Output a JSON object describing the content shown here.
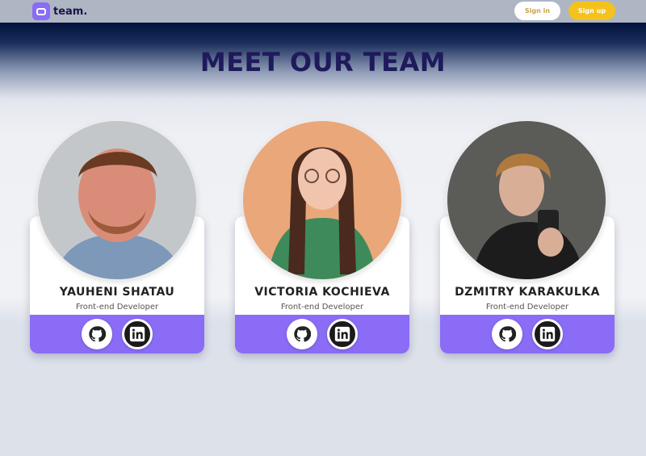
{
  "header": {
    "logo_text": "team.",
    "signin_label": "Sign in",
    "signup_label": "Sign up"
  },
  "page": {
    "title": "MEET OUR TEAM"
  },
  "team": [
    {
      "name": "YAUHENI SHATAU",
      "role": "Front-end Developer",
      "links": [
        "github-icon",
        "linkedin-icon"
      ]
    },
    {
      "name": "VICTORIA KOCHIEVA",
      "role": "Front-end Developer",
      "links": [
        "github-icon",
        "linkedin-icon"
      ]
    },
    {
      "name": "DZMITRY KARAKULKA",
      "role": "Front-end Developer",
      "links": [
        "github-icon",
        "linkedin-icon"
      ]
    }
  ],
  "colors": {
    "accent": "#8a6cf6",
    "signup": "#f4c21d",
    "title": "#1f1a5c"
  }
}
